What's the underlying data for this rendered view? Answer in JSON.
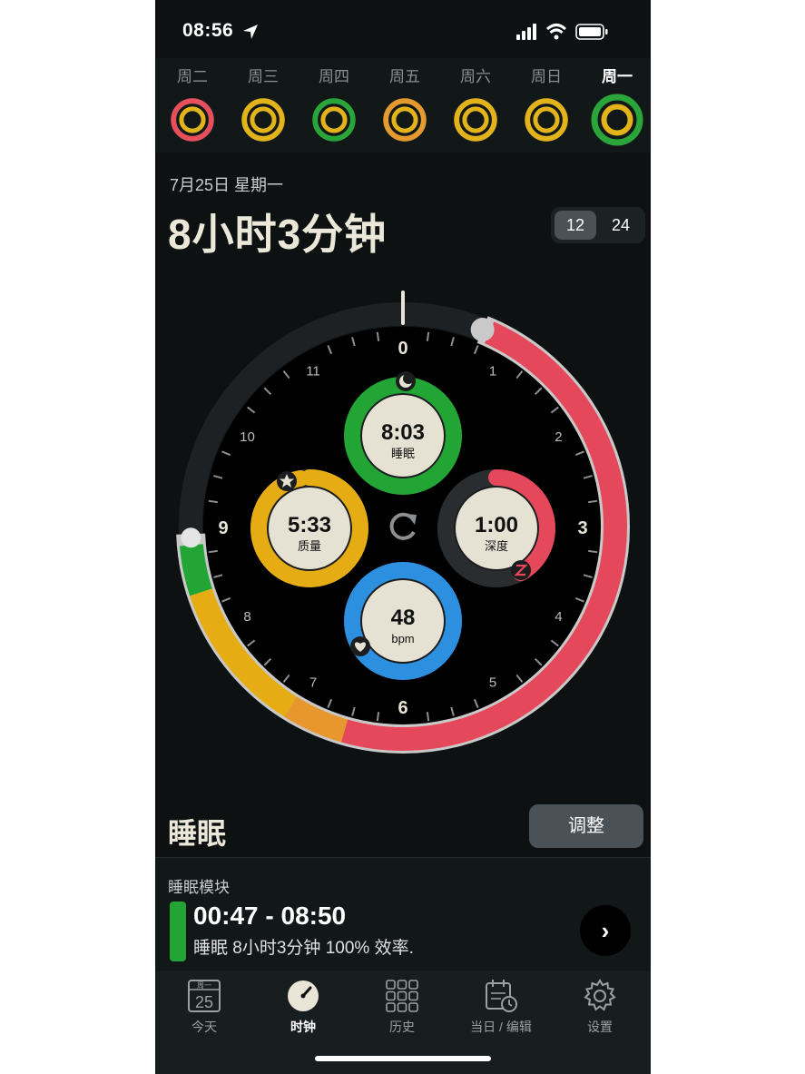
{
  "status_bar": {
    "time": "08:56"
  },
  "week": [
    {
      "label": "周二",
      "outer": "#e5505c",
      "inner": "#e2b31b"
    },
    {
      "label": "周三",
      "outer": "#e2b31b",
      "inner": "#e2b31b"
    },
    {
      "label": "周四",
      "outer": "#2aa53a",
      "inner": "#e2b31b"
    },
    {
      "label": "周五",
      "outer": "#e49a2e",
      "inner": "#e2b31b"
    },
    {
      "label": "周六",
      "outer": "#e2b31b",
      "inner": "#e2b31b"
    },
    {
      "label": "周日",
      "outer": "#e2b31b",
      "inner": "#e2b31b"
    },
    {
      "label": "周一",
      "outer": "#2aa53a",
      "inner": "#e2b31b",
      "active": true
    }
  ],
  "header": {
    "date": "7月25日 星期一",
    "duration": "8小时3分钟",
    "toggle": [
      "12",
      "24"
    ],
    "toggle_selected": "12"
  },
  "clock": {
    "hour_labels": [
      "0",
      "1",
      "2",
      "3",
      "4",
      "5",
      "6",
      "7",
      "8",
      "9",
      "10",
      "11"
    ],
    "dials": {
      "sleep": {
        "value": "8:03",
        "label": "睡眠",
        "color": "#23a536",
        "fraction": 1.0
      },
      "quality": {
        "value": "5:33",
        "label": "质量",
        "color": "#e6ac13",
        "fraction": 0.97
      },
      "deep": {
        "value": "1:00",
        "label": "深度",
        "color": "#e5485a",
        "fraction": 0.42
      },
      "heart": {
        "value": "48",
        "label": "bpm",
        "color": "#2d8fe0",
        "fraction": 1.0
      }
    },
    "arc_colors": {
      "sleep": "#23a536",
      "quality": "#e6ac13",
      "transition": "#e8962e",
      "deep": "#e5485a",
      "track": "#2a2d2f"
    }
  },
  "sleep_section": {
    "heading": "睡眠",
    "adjust_label": "调整"
  },
  "sleep_block": {
    "title": "睡眠模块",
    "range": "00:47 - 08:50",
    "summary": "睡眠 8小时3分钟 100% 效率.",
    "arrow": "›"
  },
  "tabs": [
    {
      "label": "今天",
      "icon": "calendar-icon",
      "badge_top": "周一",
      "badge_num": "25"
    },
    {
      "label": "时钟",
      "icon": "clock-icon",
      "active": true
    },
    {
      "label": "历史",
      "icon": "grid-icon"
    },
    {
      "label": "当日 / 编辑",
      "icon": "calendar-edit-icon"
    },
    {
      "label": "设置",
      "icon": "gear-icon"
    }
  ]
}
